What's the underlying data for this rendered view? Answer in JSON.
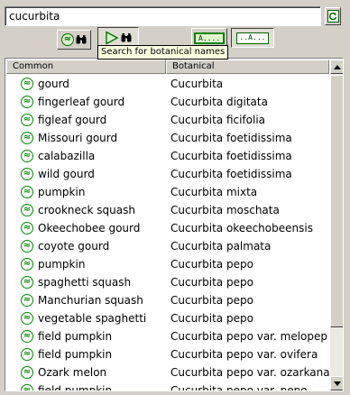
{
  "search": {
    "value": "cucurbita"
  },
  "toolbar": {
    "tooltip": "Search for botanical names",
    "name_box_label": "A....",
    "name_box_label_alt": "..A..."
  },
  "icons": {
    "refresh": "refresh-icon",
    "binoculars": "binoculars-icon",
    "play": "play-icon",
    "plant": "plant-symbol-icon",
    "scroll_up": "arrow-up-icon",
    "scroll_down": "arrow-down-icon"
  },
  "list": {
    "columns": {
      "common": "Common",
      "botanical": "Botanical"
    },
    "rows": [
      {
        "common": "gourd",
        "botanical": "Cucurbita"
      },
      {
        "common": "fingerleaf gourd",
        "botanical": "Cucurbita digitata"
      },
      {
        "common": "figleaf gourd",
        "botanical": "Cucurbita ficifolia"
      },
      {
        "common": "Missouri gourd",
        "botanical": "Cucurbita foetidissima"
      },
      {
        "common": "calabazilla",
        "botanical": "Cucurbita foetidissima"
      },
      {
        "common": "wild gourd",
        "botanical": "Cucurbita foetidissima"
      },
      {
        "common": "pumpkin",
        "botanical": "Cucurbita mixta"
      },
      {
        "common": "crookneck squash",
        "botanical": "Cucurbita moschata"
      },
      {
        "common": "Okeechobee gourd",
        "botanical": "Cucurbita okeechobeensis"
      },
      {
        "common": "coyote gourd",
        "botanical": "Cucurbita palmata"
      },
      {
        "common": "pumpkin",
        "botanical": "Cucurbita pepo"
      },
      {
        "common": "spaghetti squash",
        "botanical": "Cucurbita pepo"
      },
      {
        "common": "Manchurian squash",
        "botanical": "Cucurbita pepo"
      },
      {
        "common": "vegetable spaghetti",
        "botanical": "Cucurbita pepo"
      },
      {
        "common": "field pumpkin",
        "botanical": "Cucurbita pepo var. melopep"
      },
      {
        "common": "field pumpkin",
        "botanical": "Cucurbita pepo var. ovifera"
      },
      {
        "common": "Ozark melon",
        "botanical": "Cucurbita pepo var. ozarkana"
      },
      {
        "common": "field pumpkin",
        "botanical": "Cucurbita pepo var. pepo"
      }
    ]
  },
  "colors": {
    "accent_green": "#008a00",
    "panel": "#d4d0c8",
    "tooltip_bg": "#ffffe1"
  }
}
